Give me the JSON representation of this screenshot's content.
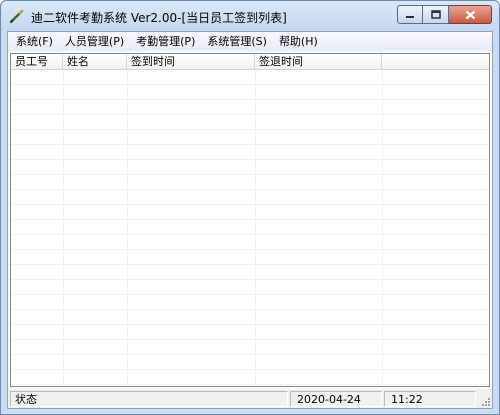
{
  "window": {
    "title": "迪二软件考勤系统 Ver2.00-[当日员工签到列表]",
    "icon": "pen-icon"
  },
  "menu": [
    {
      "label": "系统(F)",
      "name": "menu-system-file"
    },
    {
      "label": "人员管理(P)",
      "name": "menu-personnel"
    },
    {
      "label": "考勤管理(P)",
      "name": "menu-attendance"
    },
    {
      "label": "系统管理(S)",
      "name": "menu-system-admin"
    },
    {
      "label": "帮助(H)",
      "name": "menu-help"
    }
  ],
  "list": {
    "columns": [
      "员工号",
      "姓名",
      "签到时间",
      "签退时间",
      ""
    ],
    "rows": []
  },
  "status": {
    "label": "状态",
    "date": "2020-04-24",
    "time": "11:22"
  },
  "colors": {
    "frame": "#c9dcf0",
    "close_button": "#c75b45"
  }
}
